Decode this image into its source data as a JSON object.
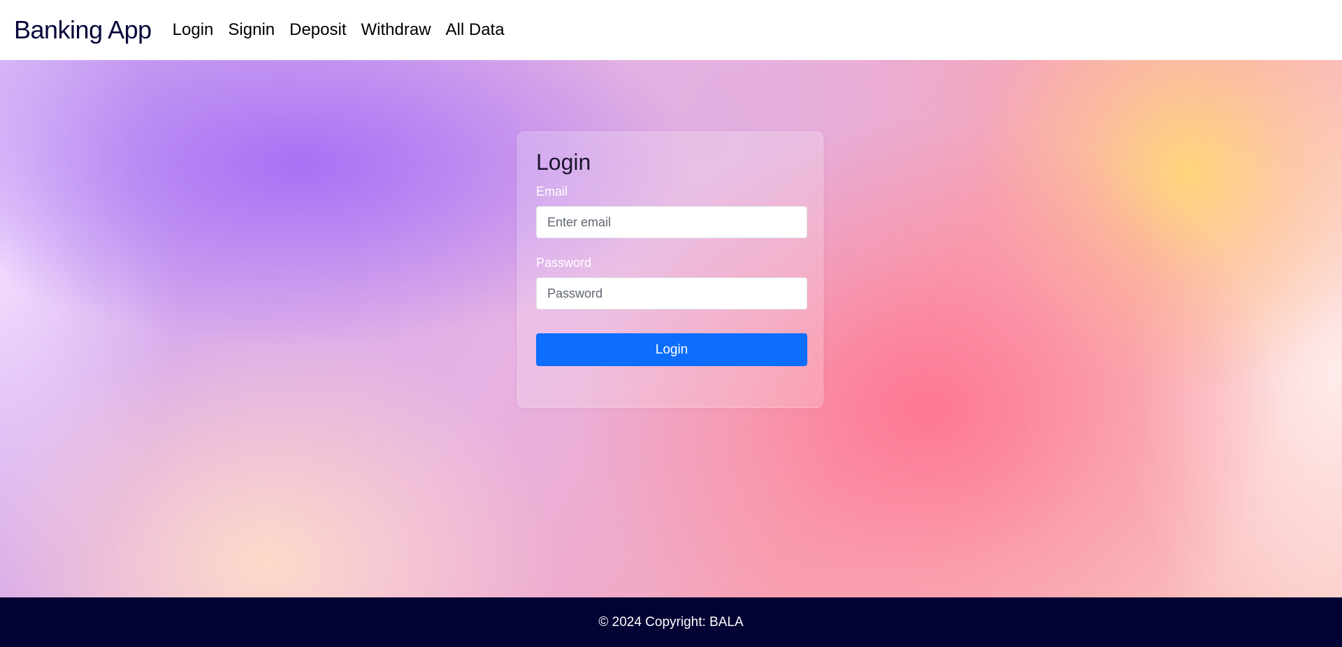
{
  "navbar": {
    "brand": "Banking App",
    "links": [
      {
        "label": "Login"
      },
      {
        "label": "Signin"
      },
      {
        "label": "Deposit"
      },
      {
        "label": "Withdraw"
      },
      {
        "label": "All Data"
      }
    ]
  },
  "login_card": {
    "title": "Login",
    "email": {
      "label": "Email",
      "value": "",
      "placeholder": "Enter email"
    },
    "password": {
      "label": "Password",
      "value": "",
      "placeholder": "Password"
    },
    "submit_label": "Login"
  },
  "footer": {
    "text": "© 2024 Copyright: BALA"
  },
  "colors": {
    "brand_text": "#06063a",
    "primary_button": "#0d6efd",
    "footer_background": "#020233"
  }
}
